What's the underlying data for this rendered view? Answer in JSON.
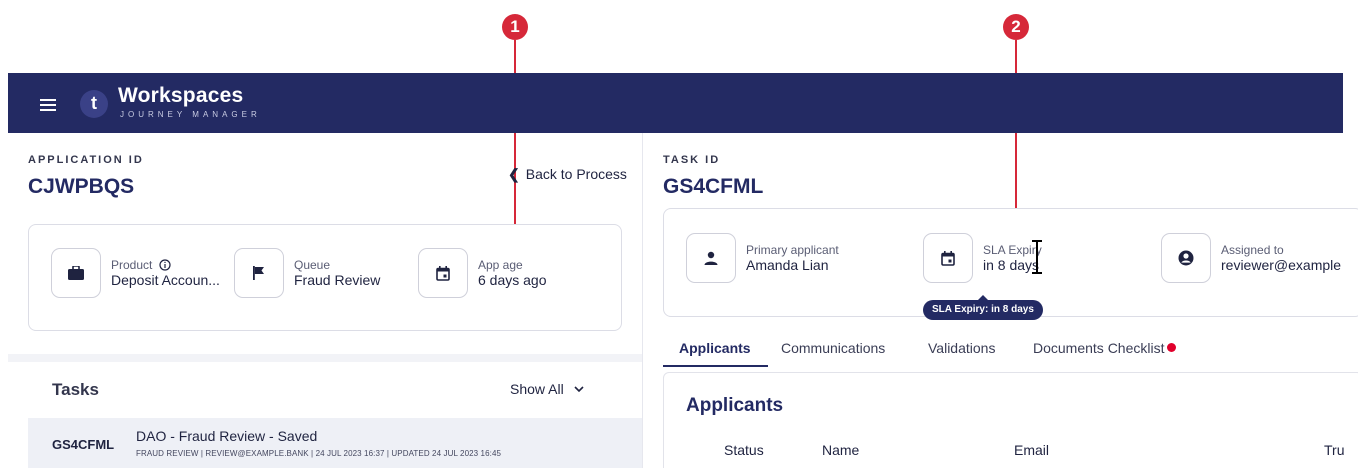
{
  "callouts": [
    "1",
    "2"
  ],
  "header": {
    "logo_letter": "t",
    "title": "Workspaces",
    "subtitle": "JOURNEY MANAGER"
  },
  "application": {
    "id_label": "APPLICATION ID",
    "id_value": "CJWPBQS",
    "back_label": "Back to Process",
    "product_label": "Product",
    "product_value": "Deposit Accoun...",
    "queue_label": "Queue",
    "queue_value": "Fraud Review",
    "age_label": "App age",
    "age_value": "6 days ago"
  },
  "tasks": {
    "title": "Tasks",
    "show_all": "Show All",
    "rows": [
      {
        "id": "GS4CFML",
        "name": "DAO - Fraud Review - Saved",
        "meta": "FRAUD REVIEW | REVIEW@EXAMPLE.BANK | 24 JUL 2023 16:37 | UPDATED 24 JUL 2023 16:45"
      }
    ]
  },
  "task": {
    "id_label": "TASK ID",
    "id_value": "GS4CFML",
    "applicant_label": "Primary applicant",
    "applicant_value": "Amanda Lian",
    "sla_label": "SLA Expiry",
    "sla_value": "in 8 days",
    "assigned_label": "Assigned to",
    "assigned_value": "reviewer@example",
    "tooltip": "SLA Expiry: in 8 days"
  },
  "tabs": [
    "Applicants",
    "Communications",
    "Validations",
    "Documents Checklist"
  ],
  "applicants": {
    "title": "Applicants",
    "columns": [
      "Status",
      "Name",
      "Email",
      "Tru"
    ]
  },
  "colors": {
    "brand": "#232a63",
    "callout": "#d62839",
    "alert_dot": "#e0002b"
  },
  "icons": [
    "menu-icon",
    "briefcase-icon",
    "info-icon",
    "flag-icon",
    "calendar-icon",
    "person-icon",
    "account-circle-icon",
    "chevron-left-icon",
    "chevron-down-icon"
  ]
}
